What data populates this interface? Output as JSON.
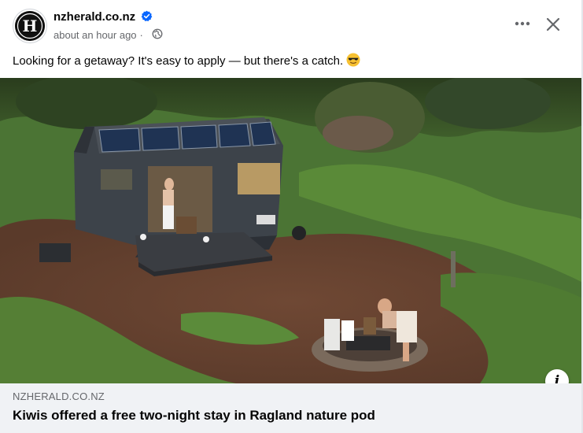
{
  "post": {
    "page_name": "nzherald.co.nz",
    "timestamp": "about an hour ago",
    "separator": "·",
    "caption": "Looking for a getaway? It's easy to apply — but there's a catch.",
    "caption_emoji": "smiling-face-with-sunglasses",
    "audience_icon": "globe-icon",
    "verified": true,
    "avatar_letter": "H"
  },
  "link_preview": {
    "domain": "NZHERALD.CO.NZ",
    "headline": "Kiwis offered a free two-night stay in Ragland nature pod",
    "info_label": "i"
  },
  "colors": {
    "verified_blue": "#0866ff",
    "meta_gray": "#65676b",
    "card_bg": "#f0f2f5",
    "pod_body": "#3b4047",
    "grass": "#4e7a32",
    "dirt": "#6b4632"
  }
}
